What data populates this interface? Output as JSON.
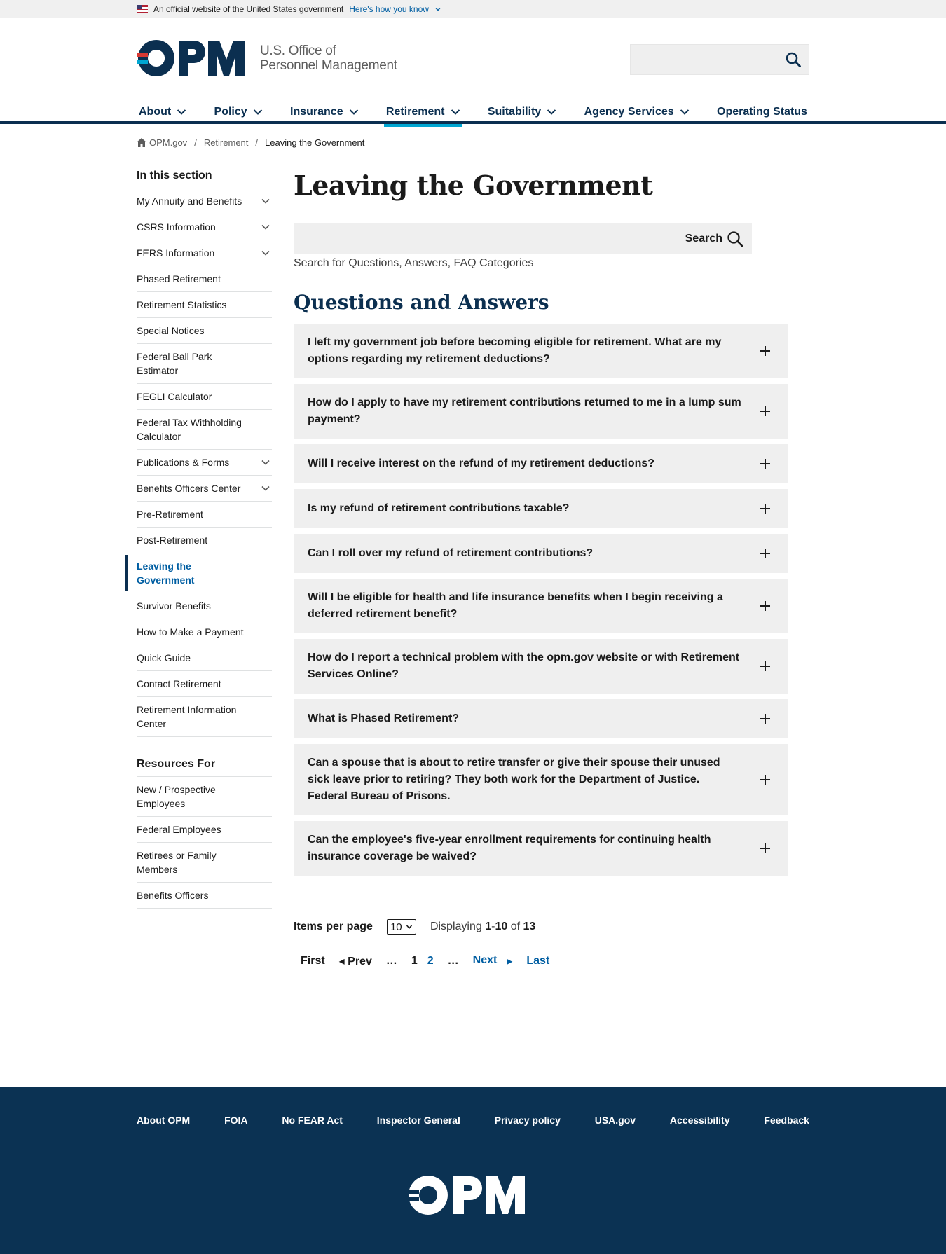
{
  "gov_banner": {
    "text": "An official website of the United States government",
    "link": "Here's how you know"
  },
  "logo": {
    "mark": "OPM",
    "name_line1": "U.S. Office of",
    "name_line2": "Personnel Management"
  },
  "nav": {
    "items": [
      {
        "label": "About",
        "dropdown": true
      },
      {
        "label": "Policy",
        "dropdown": true
      },
      {
        "label": "Insurance",
        "dropdown": true
      },
      {
        "label": "Retirement",
        "dropdown": true,
        "active": true
      },
      {
        "label": "Suitability",
        "dropdown": true
      },
      {
        "label": "Agency Services",
        "dropdown": true
      },
      {
        "label": "Operating Status",
        "dropdown": false
      }
    ]
  },
  "breadcrumb": {
    "home": "OPM.gov",
    "sep": "/",
    "level1": "Retirement",
    "current": "Leaving the Government"
  },
  "sidebar": {
    "heading": "In this section",
    "items": [
      {
        "label": "My Annuity and Benefits",
        "expandable": true
      },
      {
        "label": "CSRS Information",
        "expandable": true
      },
      {
        "label": "FERS Information",
        "expandable": true
      },
      {
        "label": "Phased Retirement"
      },
      {
        "label": "Retirement Statistics"
      },
      {
        "label": "Special Notices"
      },
      {
        "label": "Federal Ball Park Estimator"
      },
      {
        "label": "FEGLI Calculator"
      },
      {
        "label": "Federal Tax Withholding Calculator"
      },
      {
        "label": "Publications & Forms",
        "expandable": true
      },
      {
        "label": "Benefits Officers Center",
        "expandable": true
      },
      {
        "label": "Pre-Retirement"
      },
      {
        "label": "Post-Retirement"
      },
      {
        "label": "Leaving the Government",
        "active": true
      },
      {
        "label": "Survivor Benefits"
      },
      {
        "label": "How to Make a Payment"
      },
      {
        "label": "Quick Guide"
      },
      {
        "label": "Contact Retirement"
      },
      {
        "label": "Retirement Information Center"
      }
    ],
    "resources_heading": "Resources For",
    "resources": [
      {
        "label": "New / Prospective Employees"
      },
      {
        "label": "Federal Employees"
      },
      {
        "label": "Retirees or Family Members"
      },
      {
        "label": "Benefits Officers"
      }
    ]
  },
  "main": {
    "title": "Leaving the Government",
    "search_button": "Search",
    "search_hint": "Search for Questions, Answers, FAQ Categories",
    "qa_heading": "Questions and Answers",
    "faqs": [
      "I left my government job before becoming eligible for retirement. What are my options regarding my retirement deductions?",
      "How do I apply to have my retirement contributions returned to me in a lump sum payment?",
      "Will I receive interest on the refund of my retirement deductions?",
      "Is my refund of retirement contributions taxable?",
      "Can I roll over my refund of retirement contributions?",
      "Will I be eligible for health and life insurance benefits when I begin receiving a deferred retirement benefit?",
      "How do I report a technical problem with the opm.gov website or with Retirement Services Online?",
      "What is Phased Retirement?",
      "Can a spouse that is about to retire transfer or give their spouse their unused sick leave prior to retiring? They both work for the Department of Justice. Federal Bureau of Prisons.",
      "Can the employee's five-year enrollment requirements for continuing health insurance coverage be waived?"
    ],
    "pager": {
      "items_per_page_label": "Items per page",
      "items_per_page_value": "10",
      "displaying_label": "Displaying",
      "range_start": "1",
      "range_dash": "-",
      "range_end": "10",
      "of_label": "of",
      "total": "13",
      "first": "First",
      "prev": "◂ Prev",
      "ellipsis": "…",
      "page_current": "1",
      "page_next": "2",
      "next": "Next",
      "next_arrow": "▸",
      "last": "Last"
    }
  },
  "footer": {
    "links": [
      "About OPM",
      "FOIA",
      "No FEAR Act",
      "Inspector General",
      "Privacy policy",
      "USA.gov",
      "Accessibility",
      "Feedback"
    ]
  },
  "colors": {
    "navy": "#0b2f50",
    "link_blue": "#005ea2",
    "accent_cyan": "#00a6d2",
    "footer_bg": "#0b3253",
    "panel_gray": "#efefef"
  }
}
